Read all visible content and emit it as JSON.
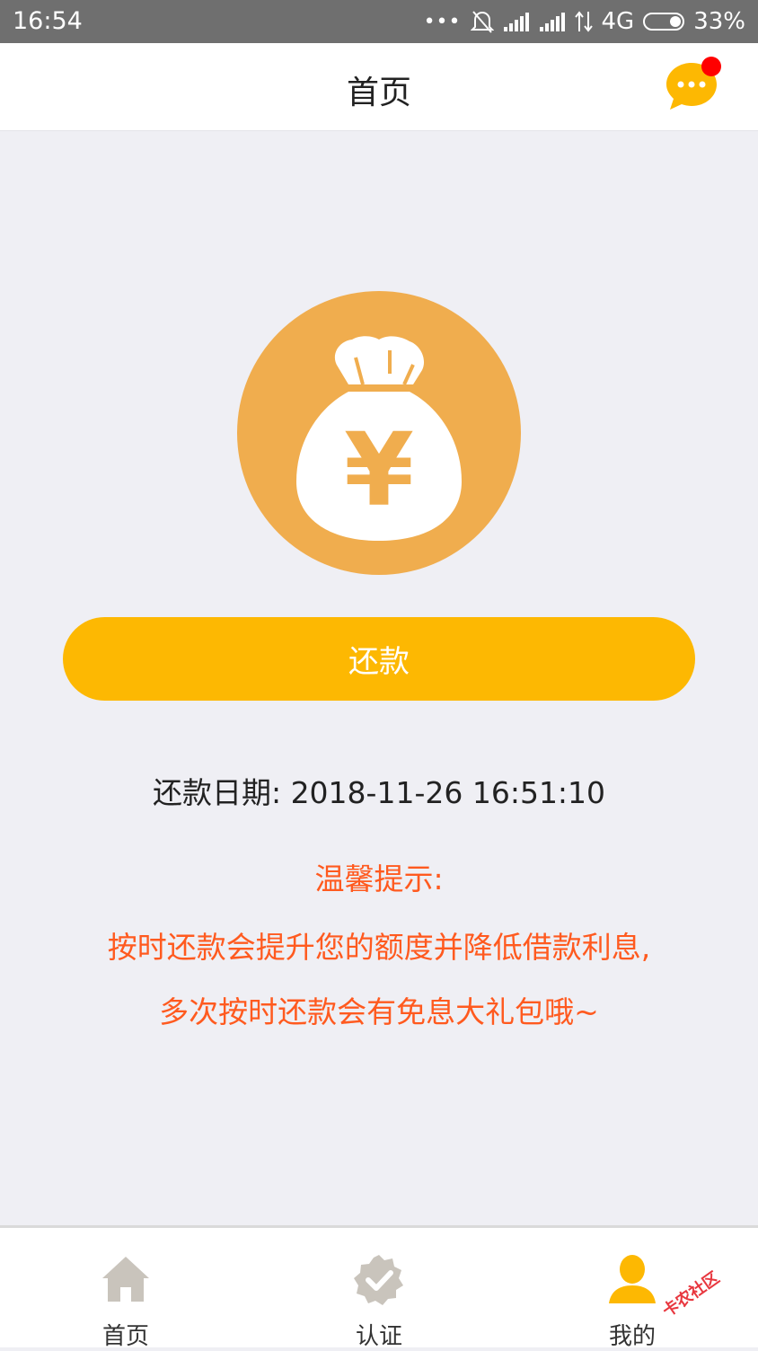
{
  "status_bar": {
    "time": "16:54",
    "network": "4G",
    "battery": "33%",
    "icons": [
      "more-dots-icon",
      "bell-off-icon",
      "signal-icon",
      "signal-icon",
      "data-arrows-icon",
      "battery-icon"
    ]
  },
  "header": {
    "title": "首页",
    "message_icon": "chat-bubble-icon",
    "has_notification_dot": true
  },
  "hero": {
    "icon": "money-bag-icon",
    "glyph": "¥"
  },
  "repay": {
    "button_label": "还款"
  },
  "repay_date": {
    "label": "还款日期: ",
    "value": "2018-11-26 16:51:10"
  },
  "tip": {
    "title": "温馨提示:",
    "line1": "按时还款会提升您的额度并降低借款利息,",
    "line2": "多次按时还款会有免息大礼包哦~"
  },
  "nav": {
    "items": [
      {
        "label": "首页",
        "icon": "home-icon",
        "active": false
      },
      {
        "label": "认证",
        "icon": "verified-badge-icon",
        "active": false
      },
      {
        "label": "我的",
        "icon": "user-icon",
        "active": true
      }
    ]
  },
  "watermark": {
    "text": "卡农社区"
  },
  "colors": {
    "primary_button": "#fdb802",
    "hero_circle": "#f0ad4e",
    "tip_text": "#ff5a1f",
    "active_icon": "#fdb802",
    "inactive_icon": "#c9c4bc",
    "notification_dot": "#ff0000"
  }
}
